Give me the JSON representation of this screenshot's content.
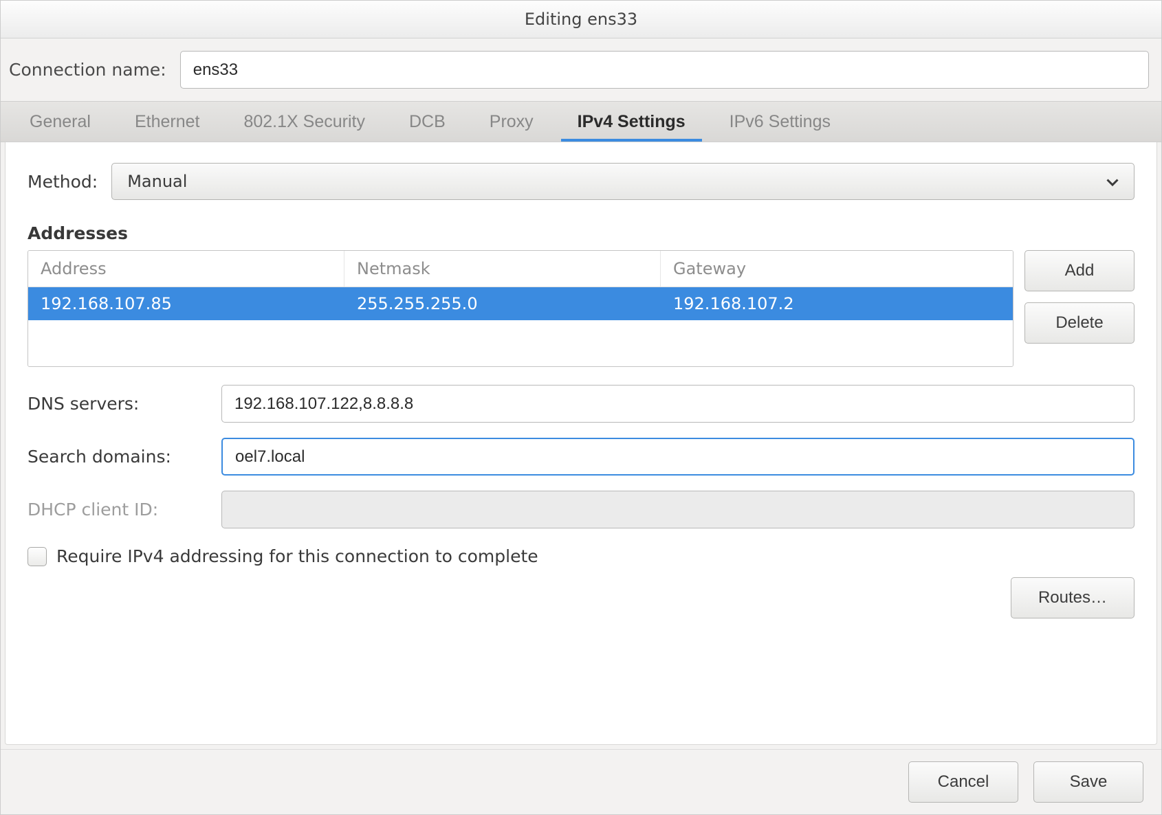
{
  "window": {
    "title": "Editing ens33"
  },
  "connection": {
    "label": "Connection name:",
    "value": "ens33"
  },
  "tabs": [
    {
      "label": "General"
    },
    {
      "label": "Ethernet"
    },
    {
      "label": "802.1X Security"
    },
    {
      "label": "DCB"
    },
    {
      "label": "Proxy"
    },
    {
      "label": "IPv4 Settings"
    },
    {
      "label": "IPv6 Settings"
    }
  ],
  "method": {
    "label": "Method:",
    "value": "Manual"
  },
  "addresses": {
    "heading": "Addresses",
    "headers": {
      "address": "Address",
      "netmask": "Netmask",
      "gateway": "Gateway"
    },
    "rows": [
      {
        "address": "192.168.107.85",
        "netmask": "255.255.255.0",
        "gateway": "192.168.107.2"
      }
    ],
    "add_label": "Add",
    "delete_label": "Delete"
  },
  "dns": {
    "label": "DNS servers:",
    "value": "192.168.107.122,8.8.8.8"
  },
  "search": {
    "label": "Search domains:",
    "value": "oel7.local"
  },
  "dhcp": {
    "label": "DHCP client ID:",
    "value": ""
  },
  "require_ipv4": {
    "label": "Require IPv4 addressing for this connection to complete",
    "checked": false
  },
  "routes_label": "Routes…",
  "footer": {
    "cancel": "Cancel",
    "save": "Save"
  }
}
